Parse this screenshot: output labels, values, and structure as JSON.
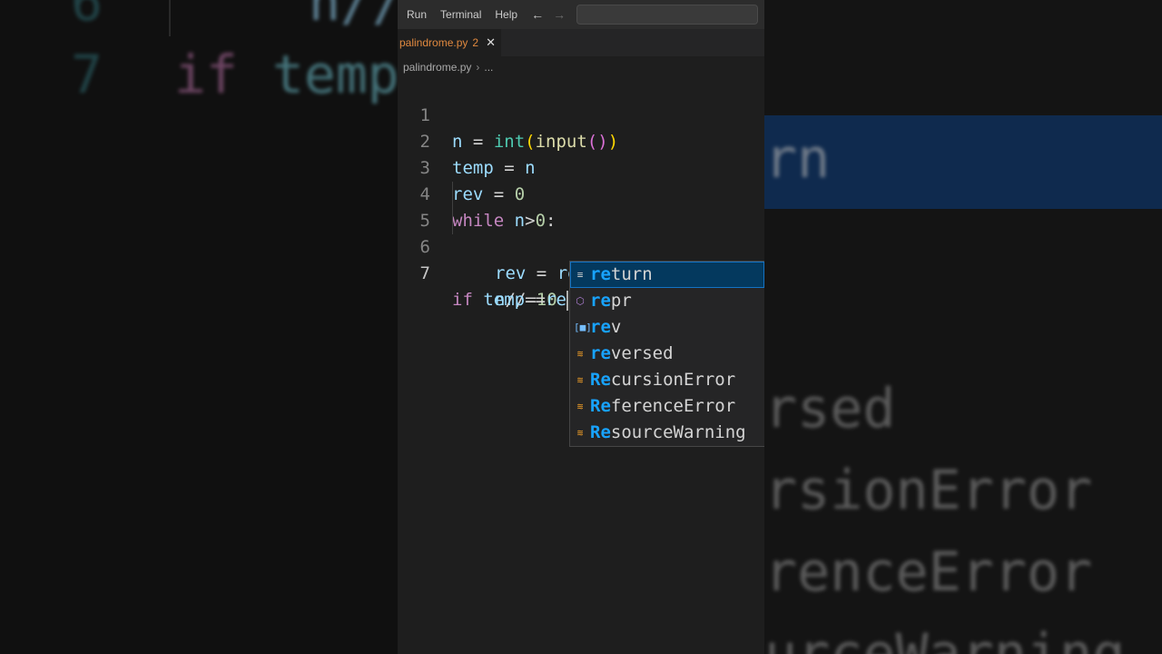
{
  "menu": {
    "items": [
      "Run",
      "Terminal",
      "Help"
    ]
  },
  "tab": {
    "filename": "palindrome.py",
    "problems": "2"
  },
  "breadcrumb": {
    "file": "palindrome.py",
    "rest": "..."
  },
  "code_lines": [
    {
      "num": "1",
      "text": "n = int(input())"
    },
    {
      "num": "2",
      "text": "temp = n"
    },
    {
      "num": "3",
      "text": "rev = 0"
    },
    {
      "num": "4",
      "text": "while n>0:"
    },
    {
      "num": "5",
      "text": "rev = rev *10+n%10"
    },
    {
      "num": "6",
      "text": "n//=10"
    },
    {
      "num": "7",
      "text": "if temp==re"
    }
  ],
  "suggestions": {
    "items": [
      {
        "icon": "keyword-icon",
        "match": "re",
        "rest": "turn",
        "selected": true
      },
      {
        "icon": "function-icon",
        "match": "re",
        "rest": "pr",
        "selected": false
      },
      {
        "icon": "variable-icon",
        "match": "re",
        "rest": "v",
        "selected": false
      },
      {
        "icon": "class-icon",
        "match": "re",
        "rest": "versed",
        "selected": false
      },
      {
        "icon": "class-icon",
        "match": "Re",
        "rest": "cursionError",
        "selected": false
      },
      {
        "icon": "class-icon",
        "match": "Re",
        "rest": "ferenceError",
        "selected": false
      },
      {
        "icon": "class-icon",
        "match": "Re",
        "rest": "sourceWarning",
        "selected": false
      }
    ]
  },
  "background_left": {
    "line6_num": "6",
    "line6_code": "n//",
    "line7_num": "7",
    "line7_if": "if",
    "line7_temp": "temp"
  },
  "background_right": {
    "fragments": [
      "rn",
      "rsed",
      "rsionError",
      "renceError",
      "urceWarning"
    ]
  }
}
